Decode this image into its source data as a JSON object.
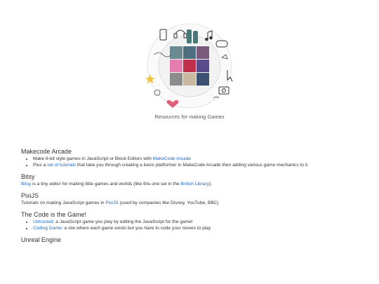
{
  "hero": {
    "caption": "Resources for making Games",
    "icons": [
      "phone-icon",
      "headphones-icon",
      "sneakers-icon",
      "gamepad-icon",
      "camera-icon",
      "heart-icon",
      "star-icon",
      "cursor-icon",
      "music-note-icon"
    ]
  },
  "sections": {
    "makecode": {
      "title": "Makecode Arcade",
      "item1_text": "Make 8-bit style games in JavaScript or Block Editors with ",
      "item1_link": "MakeCode Arcade",
      "item2_pre": "Plus a ",
      "item2_link": "set of tutorials",
      "item2_post": " that take you through creating a basic platformer in MakeCode Arcade then adding various game mechanics to it."
    },
    "bitsy": {
      "title": "Bitsy",
      "link1": "Bitsy",
      "text": " is a tiny editor for making little games and worlds (like this one set in the ",
      "link2": "British Library",
      "post": ")."
    },
    "pixijs": {
      "title": "PixiJS",
      "pre": "Tutorials on making JavaScript games in ",
      "link": "PixiJS",
      "post": " (used by companies like Disney, YouTube, BBC)"
    },
    "codegame": {
      "title": "The Code is the Game!",
      "item1_link": "Untrusted",
      "item1_text": ": a JavaScript game you play by editing the JavaScript for the game!",
      "item2_link": "Coding Game",
      "item2_text": ": a site where each game exists but you have to code your moves to play"
    },
    "unreal": {
      "title": "Unreal Engine"
    }
  },
  "colors": {
    "link": "#1a66cc",
    "text": "#333333",
    "heading": "#333333"
  }
}
